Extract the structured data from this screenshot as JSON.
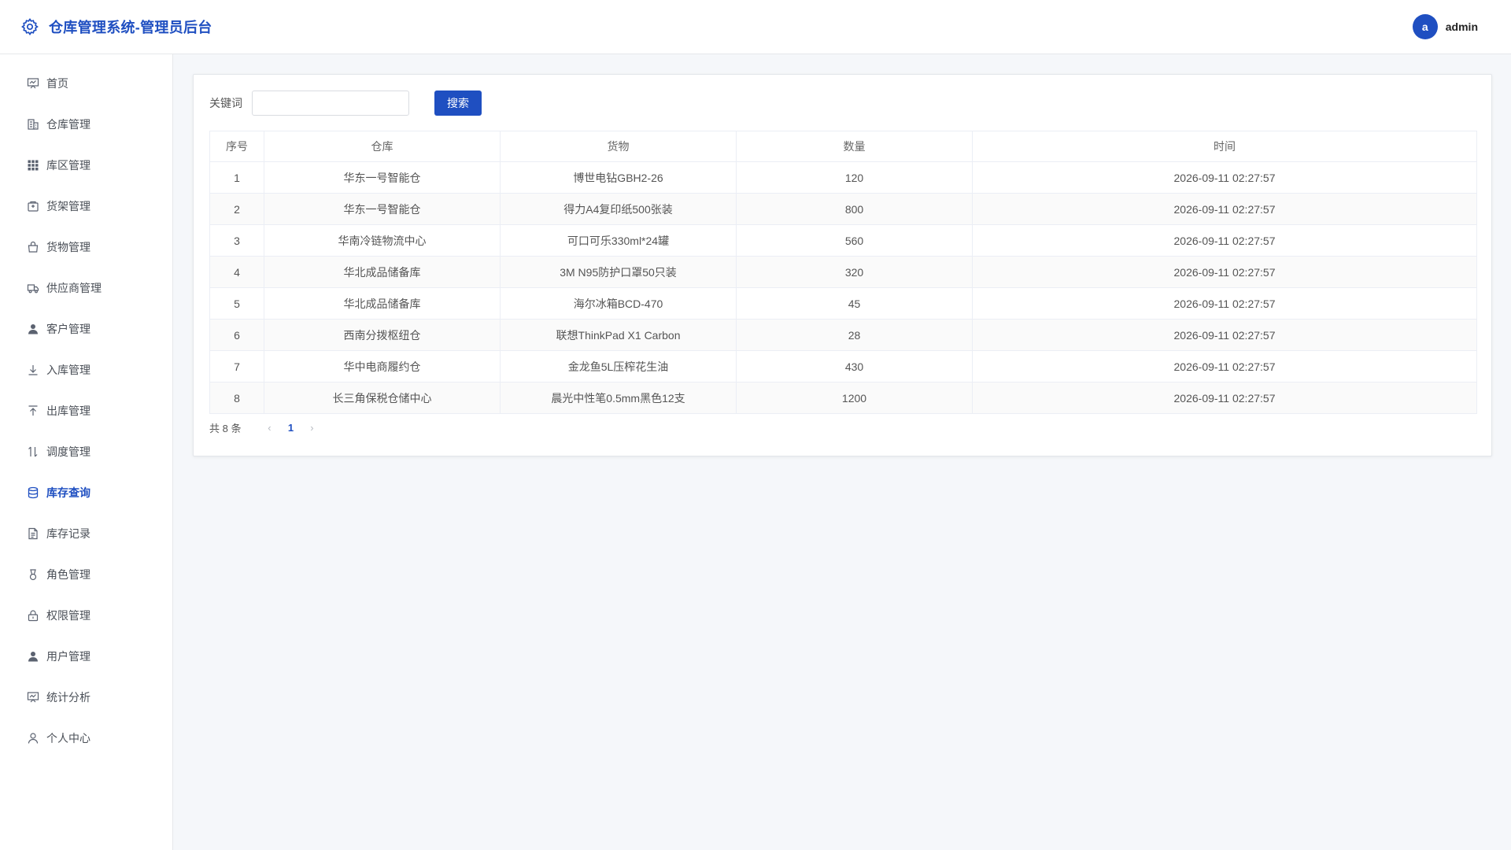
{
  "header": {
    "title": "仓库管理系统-管理员后台",
    "avatar_letter": "a",
    "username": "admin",
    "accent": "#1f4fc1"
  },
  "sidebar": {
    "items": [
      {
        "label": "首页",
        "icon": "dashboard-icon"
      },
      {
        "label": "仓库管理",
        "icon": "building-icon"
      },
      {
        "label": "库区管理",
        "icon": "grid-icon"
      },
      {
        "label": "货架管理",
        "icon": "shelf-icon"
      },
      {
        "label": "货物管理",
        "icon": "bag-icon"
      },
      {
        "label": "供应商管理",
        "icon": "truck-icon"
      },
      {
        "label": "客户管理",
        "icon": "user-icon"
      },
      {
        "label": "入库管理",
        "icon": "download-icon"
      },
      {
        "label": "出库管理",
        "icon": "upload-icon"
      },
      {
        "label": "调度管理",
        "icon": "transfer-icon"
      },
      {
        "label": "库存查询",
        "icon": "database-icon"
      },
      {
        "label": "库存记录",
        "icon": "document-icon"
      },
      {
        "label": "角色管理",
        "icon": "role-icon"
      },
      {
        "label": "权限管理",
        "icon": "lock-icon"
      },
      {
        "label": "用户管理",
        "icon": "user-filled-icon"
      },
      {
        "label": "统计分析",
        "icon": "chart-icon"
      },
      {
        "label": "个人中心",
        "icon": "person-icon"
      }
    ],
    "active_index": 10
  },
  "search": {
    "label": "关键词",
    "value": "",
    "placeholder": "",
    "button": "搜索"
  },
  "table": {
    "columns": [
      "序号",
      "仓库",
      "货物",
      "数量",
      "时间"
    ],
    "rows": [
      [
        "1",
        "华东一号智能仓",
        "博世电钻GBH2-26",
        "120",
        "2026-09-11 02:27:57"
      ],
      [
        "2",
        "华东一号智能仓",
        "得力A4复印纸500张装",
        "800",
        "2026-09-11 02:27:57"
      ],
      [
        "3",
        "华南冷链物流中心",
        "可口可乐330ml*24罐",
        "560",
        "2026-09-11 02:27:57"
      ],
      [
        "4",
        "华北成品储备库",
        "3M N95防护口罩50只装",
        "320",
        "2026-09-11 02:27:57"
      ],
      [
        "5",
        "华北成品储备库",
        "海尔冰箱BCD-470",
        "45",
        "2026-09-11 02:27:57"
      ],
      [
        "6",
        "西南分拨枢纽仓",
        "联想ThinkPad X1 Carbon",
        "28",
        "2026-09-11 02:27:57"
      ],
      [
        "7",
        "华中电商履约仓",
        "金龙鱼5L压榨花生油",
        "430",
        "2026-09-11 02:27:57"
      ],
      [
        "8",
        "长三角保税仓储中心",
        "晨光中性笔0.5mm黑色12支",
        "1200",
        "2026-09-11 02:27:57"
      ]
    ]
  },
  "pagination": {
    "total_text": "共 8 条",
    "current_page": "1",
    "prev": "‹",
    "next": "›"
  }
}
